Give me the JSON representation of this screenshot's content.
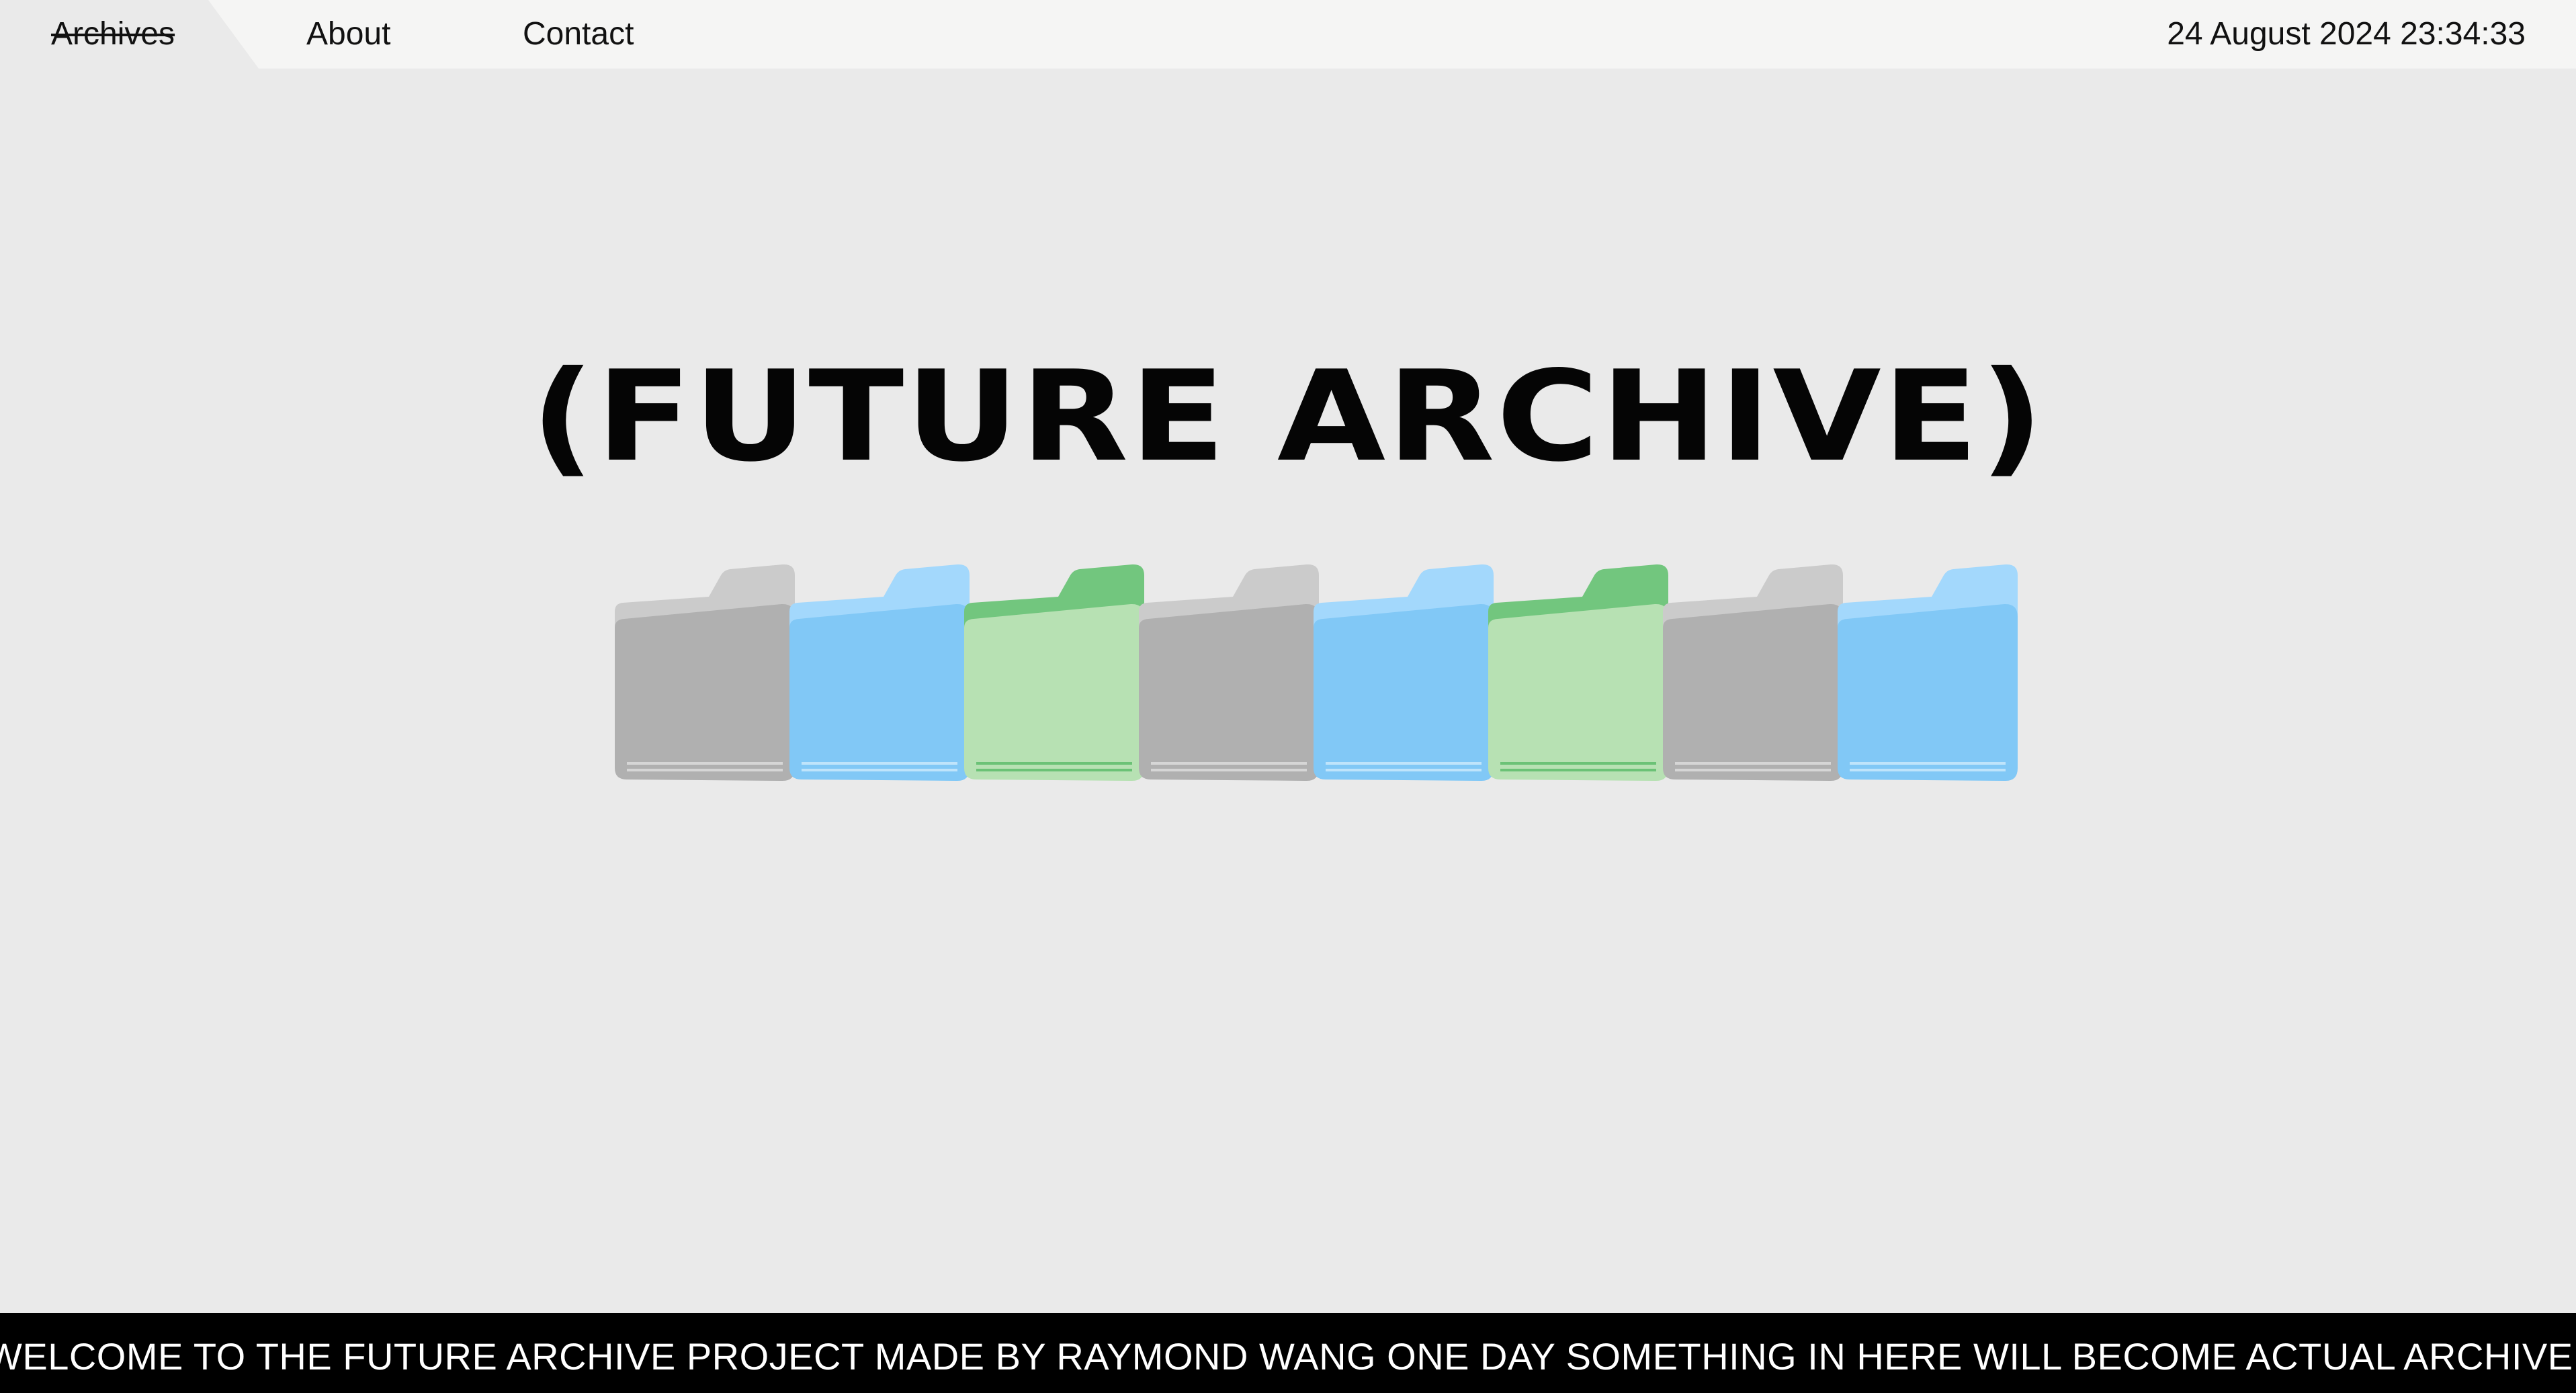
{
  "nav": {
    "items": [
      {
        "label": "Archives",
        "active": true
      },
      {
        "label": "About",
        "active": false
      },
      {
        "label": "Contact",
        "active": false
      }
    ],
    "datetime": "24 August 2024 23:34:33"
  },
  "hero": {
    "title": "(FUTURE ARCHIVE)"
  },
  "folders": [
    {
      "color": "gray",
      "icon": "folder-icon"
    },
    {
      "color": "blue",
      "icon": "folder-icon"
    },
    {
      "color": "green",
      "icon": "folder-icon"
    },
    {
      "color": "gray",
      "icon": "folder-icon"
    },
    {
      "color": "blue",
      "icon": "folder-icon"
    },
    {
      "color": "green",
      "icon": "folder-icon"
    },
    {
      "color": "gray",
      "icon": "folder-icon"
    },
    {
      "color": "blue",
      "icon": "folder-icon"
    }
  ],
  "palette": {
    "gray": {
      "tab": "#cbcbcb",
      "front": "#b0b0b0",
      "line": "#d6d6d6"
    },
    "blue": {
      "tab": "#a3d8fc",
      "front": "#81c8f6",
      "line": "#bfe4fb"
    },
    "green": {
      "tab": "#72c67e",
      "front": "#b7e1b3",
      "line": "#6bc276"
    }
  },
  "ticker": {
    "text": "WELCOME TO THE FUTURE ARCHIVE PROJECT MADE BY RAYMOND WANG ONE DAY SOMETHING IN HERE WILL BECOME ACTUAL ARCHIVE THAT I"
  }
}
